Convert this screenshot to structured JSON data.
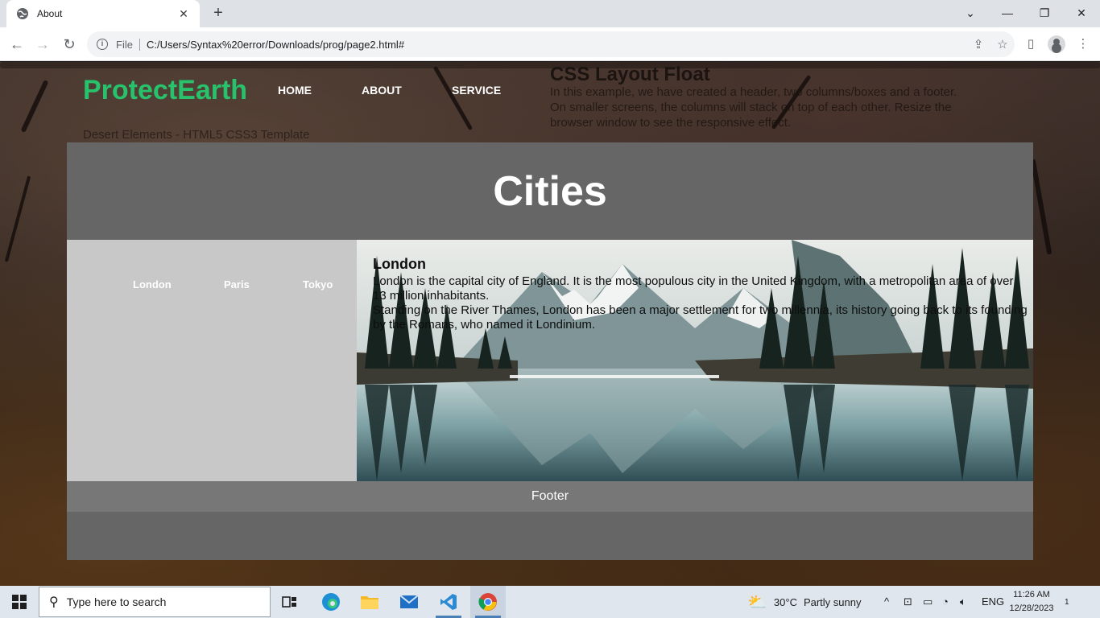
{
  "browser": {
    "tab_title": "About",
    "tab_close": "✕",
    "new_tab": "+",
    "scheme": "File",
    "url": "C:/Users/Syntax%20error/Downloads/prog/page2.html#",
    "win_controls": [
      "⌄",
      "—",
      "❐",
      "✕"
    ]
  },
  "site": {
    "logo": "ProtectEarth",
    "nav": [
      "HOME",
      "ABOUT",
      "SERVICE"
    ],
    "bg_heading": "CSS Layout Float",
    "bg_paragraph": "In this example, we have created a header, two columns/boxes and a footer. On smaller screens, the columns will stack on top of each other. Resize the browser window to see the responsive effect.",
    "bg_caption": "Desert Elements - HTML5 CSS3 Template"
  },
  "page": {
    "heading": "Cities",
    "cities": [
      "London",
      "Paris",
      "Tokyo"
    ],
    "article_title": "London",
    "article_p1": "London is the capital city of England. It is the most populous city in the United Kingdom, with a metropolitan area of over 13 million inhabitants.",
    "article_p2": "Standing on the River Thames, London has been a major settlement for two millennia, its history going back to its founding by the Romans, who named it Londinium.",
    "footer": "Footer"
  },
  "taskbar": {
    "search_placeholder": "Type here to search",
    "apps": [
      "task-view",
      "edge",
      "file-explorer",
      "mail",
      "vscode",
      "chrome"
    ],
    "weather_temp": "30°C",
    "weather_text": "Partly sunny",
    "language": "ENG",
    "time": "11:26 AM",
    "date": "12/28/2023",
    "notification_count": "1"
  },
  "colors": {
    "logo_green": "#27c26b",
    "container_gray": "#666666",
    "sidebar_gray": "#c8c8c8",
    "footer_gray": "#777777"
  }
}
